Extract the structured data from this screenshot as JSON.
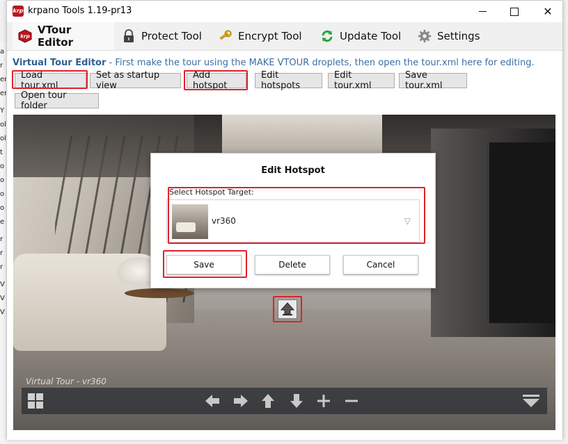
{
  "window": {
    "title": "krpano Tools 1.19-pr13",
    "icon_text": "krp"
  },
  "tabs": [
    {
      "label": "VTour Editor",
      "icon": "krpano-logo-icon"
    },
    {
      "label": "Protect Tool",
      "icon": "padlock-icon"
    },
    {
      "label": "Encrypt Tool",
      "icon": "key-icon"
    },
    {
      "label": "Update Tool",
      "icon": "refresh-icon"
    },
    {
      "label": "Settings",
      "icon": "gear-icon"
    }
  ],
  "intro": {
    "title": "Virtual Tour Editor",
    "text": " - First make the tour using the MAKE VTOUR droplets, then open the tour.xml here for editing."
  },
  "toolbar": {
    "load": "Load tour.xml",
    "startup": "Set as startup view",
    "add_hotspot": "Add hotspot",
    "edit_hotspots": "Edit hotspots",
    "edit_xml": "Edit tour.xml",
    "save_xml": "Save tour.xml",
    "open_folder": "Open tour folder"
  },
  "viewer": {
    "label": "Virtual Tour - vr360"
  },
  "dialog": {
    "title": "Edit Hotspot",
    "target_label": "Select Hotspot Target:",
    "selected_target": "vr360",
    "save": "Save",
    "delete": "Delete",
    "cancel": "Cancel"
  },
  "colors": {
    "highlight": "#e0202a",
    "intro_link": "#3a6ea5"
  }
}
